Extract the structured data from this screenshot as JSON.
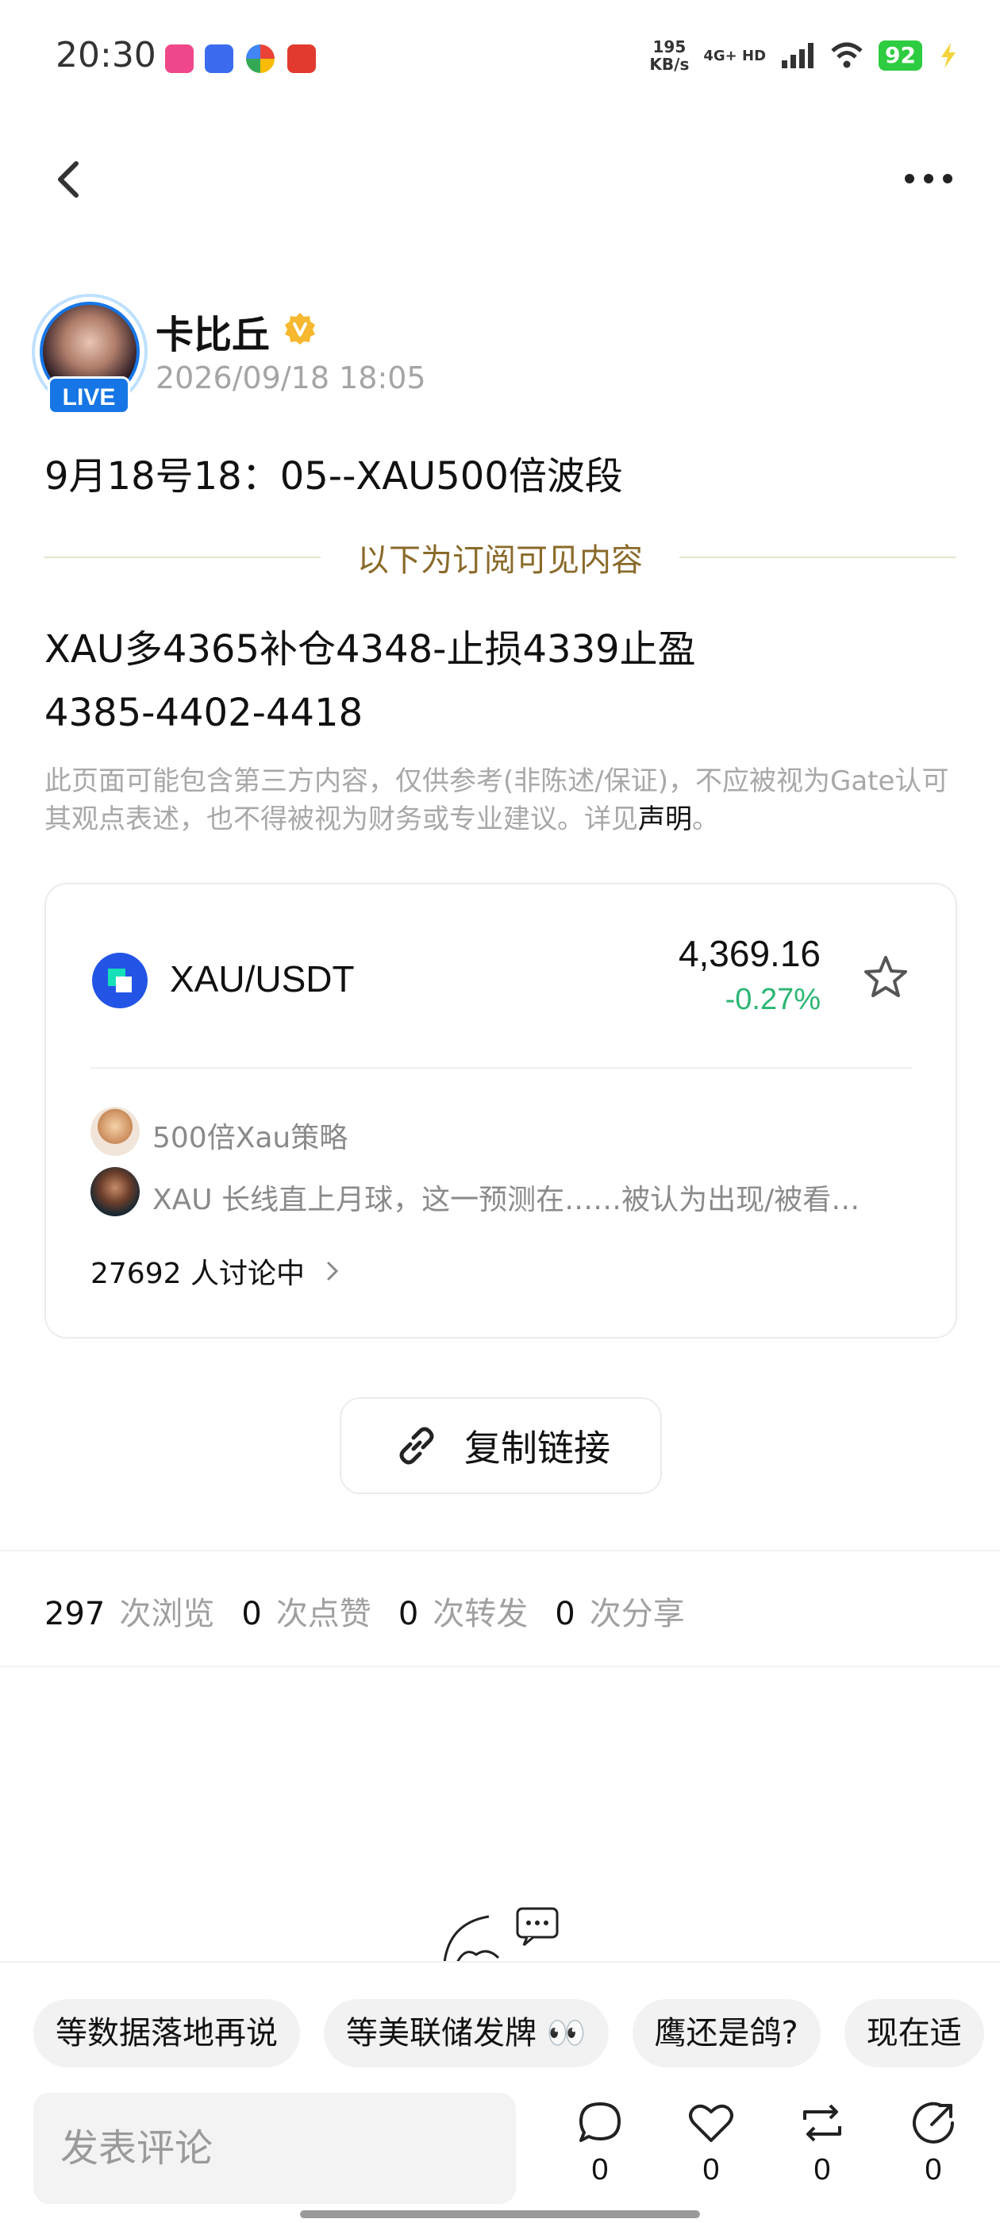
{
  "status_bar": {
    "time": "20:30",
    "net_speed_value": "195",
    "net_speed_unit": "KB/s",
    "net_type": "4G+ HD",
    "battery": "92",
    "app_icons": [
      "app-icon-pink",
      "app-icon-blue",
      "app-icon-chrome",
      "app-icon-red"
    ]
  },
  "header": {
    "back_icon": "chevron-left-icon",
    "more_icon": "more-dots-icon"
  },
  "author": {
    "name": "卡比丘",
    "live_badge": "LIVE",
    "timestamp": "2026/09/18 18:05",
    "verified_icon": "verified-badge-icon"
  },
  "post": {
    "title": "9月18号18：05--XAU500倍波段",
    "subscription_label": "以下为订阅可见内容",
    "body_line1": "XAU多4365补仓4348-止损4339止盈",
    "body_line2": "4385-4402-4418",
    "disclaimer_text": "此页面可能包含第三方内容，仅供参考(非陈述/保证)，不应被视为Gate认可其观点表述，也不得被视为财务或专业建议。详见",
    "disclaimer_link": "声明",
    "disclaimer_end": "。"
  },
  "market_card": {
    "pair": "XAU/USDT",
    "price": "4,369.16",
    "change": "-0.27%",
    "change_color": "#2bb673",
    "discussions": [
      {
        "title": "500倍Xau策略"
      },
      {
        "title": "XAU 长线直上月球，这一预测在……被认为出现/被看…"
      }
    ],
    "discuss_count": "27692 人讨论中"
  },
  "copy_link": {
    "label": "复制链接"
  },
  "stats": {
    "views": "297",
    "views_label": "次浏览",
    "likes": "0",
    "likes_label": "次点赞",
    "reposts": "0",
    "reposts_label": "次转发",
    "shares": "0",
    "shares_label": "次分享"
  },
  "bottom_bar": {
    "chips": [
      "等数据落地再说",
      "等美联储发牌 👀",
      "鹰还是鸽?",
      "现在适"
    ],
    "comment_placeholder": "发表评论",
    "actions": [
      {
        "icon": "comment-icon",
        "count": "0"
      },
      {
        "icon": "heart-icon",
        "count": "0"
      },
      {
        "icon": "repost-icon",
        "count": "0"
      },
      {
        "icon": "share-icon",
        "count": "0"
      }
    ]
  },
  "colors": {
    "accent_blue": "#1676e6",
    "positive_green": "#2bb673",
    "subscription_gold": "#8a6a2a"
  }
}
